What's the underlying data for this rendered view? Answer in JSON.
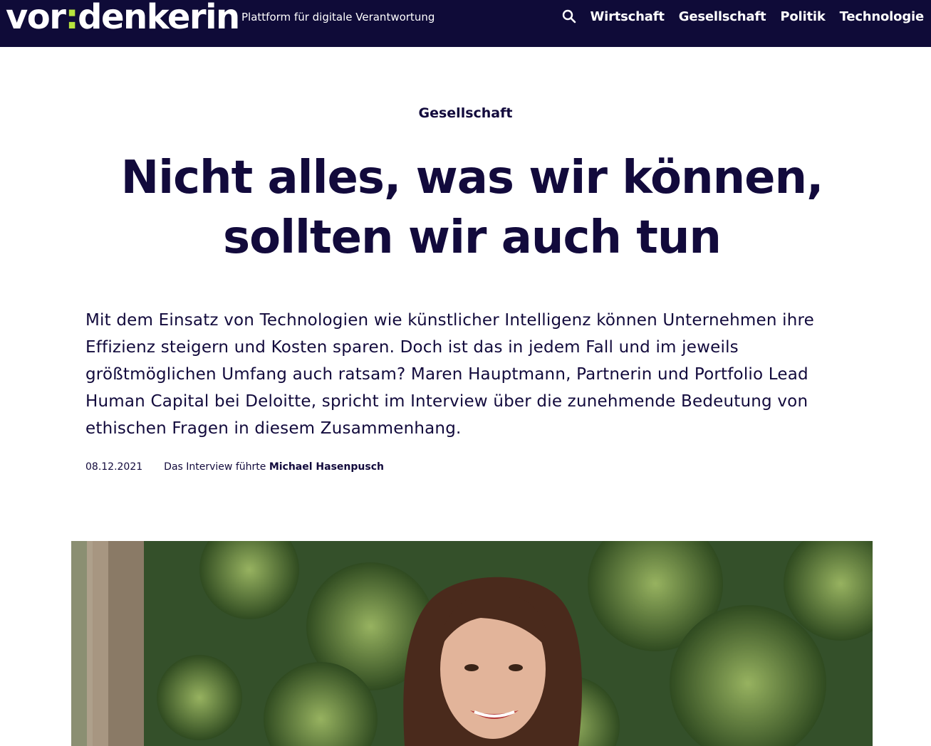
{
  "header": {
    "logo_part1": "vor",
    "logo_colon": ":",
    "logo_part2": "denkerin",
    "tagline": "Plattform für digitale Verantwortung",
    "search_icon": "search-icon",
    "nav": [
      "Wirtschaft",
      "Gesellschaft",
      "Politik",
      "Technologie"
    ]
  },
  "article": {
    "category": "Gesellschaft",
    "title": "Nicht alles, was wir können, sollten wir auch tun",
    "lead": "Mit dem Einsatz von Technologien wie künstlicher Intelligenz können Unternehmen ihre Effizienz steigern und Kosten sparen. Doch ist das in jedem Fall und im jeweils größtmöglichen Umfang auch ratsam? Maren Hauptmann, Partnerin und Portfolio Lead Human Capital bei Deloitte, spricht im Interview über die zunehmende Bedeutung von ethischen Fragen in diesem Zusammenhang.",
    "date": "08.12.2021",
    "byline_prefix": "Das Interview führte",
    "author": "Michael Hasenpusch",
    "image_description": "portrait photo"
  },
  "colors": {
    "header_bg": "#0f0b38",
    "accent": "#b7e33d",
    "text": "#120a3c"
  }
}
